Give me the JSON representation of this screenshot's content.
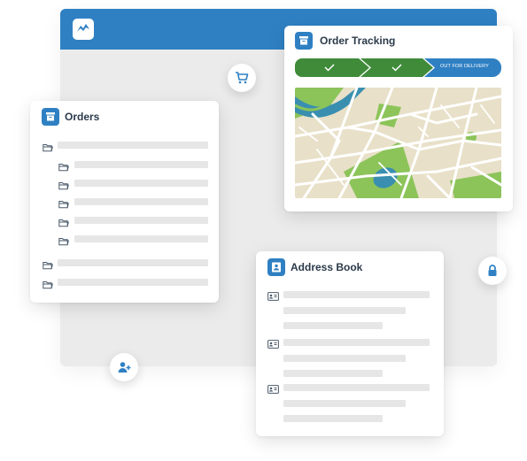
{
  "orders": {
    "title": "Orders"
  },
  "tracking": {
    "title": "Order Tracking",
    "status_label": "OUT FOR DELIVERY",
    "steps_completed": 2,
    "steps_total": 3
  },
  "address_book": {
    "title": "Address Book"
  },
  "icons": {
    "logo": "logo-mark",
    "cart": "cart-icon",
    "lock": "lock-icon",
    "add_user": "add-user-icon",
    "folder": "folder-icon",
    "contact": "contact-card-icon"
  },
  "colors": {
    "header_blue": "#2f80c3",
    "step_green": "#3f8b3a",
    "status_blue": "#2f80c3",
    "map_land": "#e8e0c8",
    "map_park": "#8cc45a",
    "map_water": "#3a8fb0"
  }
}
